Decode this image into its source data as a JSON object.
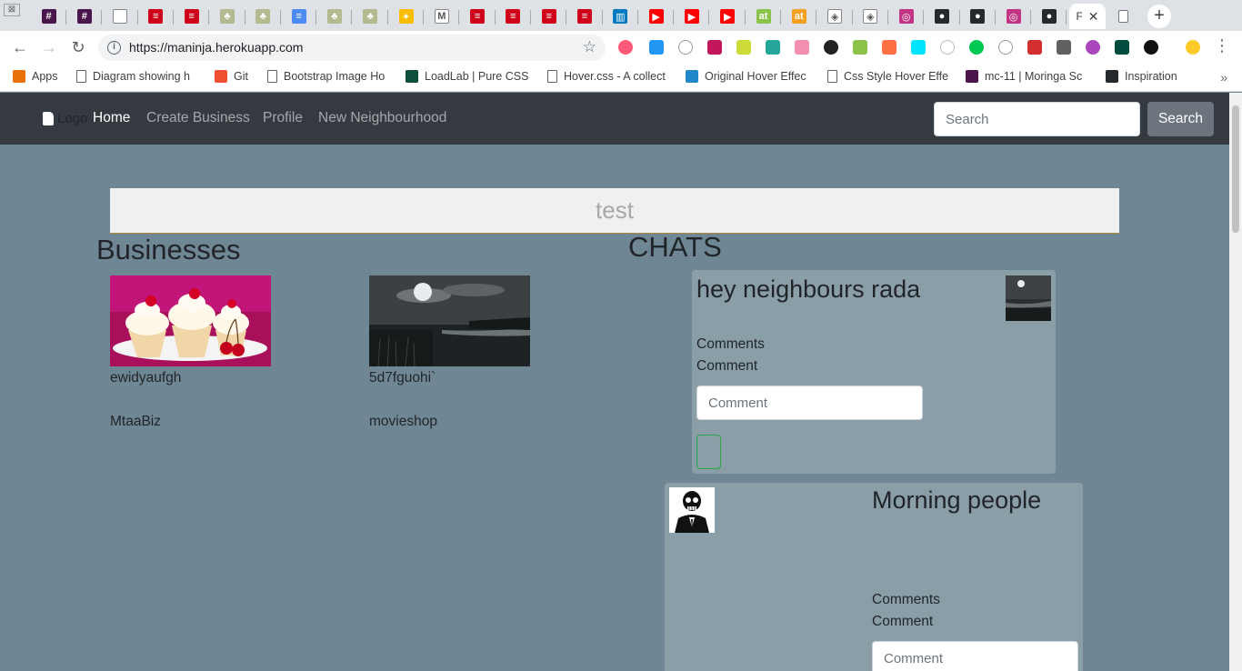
{
  "browser": {
    "tabs": [
      {
        "icon": "slack-hash-icon",
        "color": "#4a154b",
        "glyph": "#"
      },
      {
        "icon": "slack-hash-icon",
        "color": "#4a154b",
        "glyph": "#"
      },
      {
        "icon": "page-icon",
        "color": "#ffffff",
        "glyph": ""
      },
      {
        "icon": "red-bars-icon",
        "color": "#d0021b",
        "glyph": "≡"
      },
      {
        "icon": "red-bars-icon",
        "color": "#d0021b",
        "glyph": "≡"
      },
      {
        "icon": "tree-icon",
        "color": "#b5b98f",
        "glyph": "♣"
      },
      {
        "icon": "tree-icon",
        "color": "#b5b98f",
        "glyph": "♣"
      },
      {
        "icon": "docs-icon",
        "color": "#4c8bf5",
        "glyph": "≡"
      },
      {
        "icon": "tree-icon",
        "color": "#b5b98f",
        "glyph": "♣"
      },
      {
        "icon": "tree-icon",
        "color": "#b5b98f",
        "glyph": "♣"
      },
      {
        "icon": "keep-bulb-icon",
        "color": "#fbbc04",
        "glyph": "✦"
      },
      {
        "icon": "gmail-icon",
        "color": "#ffffff",
        "glyph": "M"
      },
      {
        "icon": "red-bars-icon",
        "color": "#d0021b",
        "glyph": "≡"
      },
      {
        "icon": "red-bars-icon",
        "color": "#d0021b",
        "glyph": "≡"
      },
      {
        "icon": "red-bars-icon",
        "color": "#d0021b",
        "glyph": "≡"
      },
      {
        "icon": "red-bars-icon",
        "color": "#d0021b",
        "glyph": "≡"
      },
      {
        "icon": "trello-icon",
        "color": "#0079bf",
        "glyph": "▥"
      },
      {
        "icon": "youtube-icon",
        "color": "#ff0000",
        "glyph": "▶"
      },
      {
        "icon": "youtube-icon",
        "color": "#ff0000",
        "glyph": "▶"
      },
      {
        "icon": "youtube-icon",
        "color": "#ff0000",
        "glyph": "▶"
      },
      {
        "icon": "at-icon",
        "color": "#8bc34a",
        "glyph": "at"
      },
      {
        "icon": "at-icon",
        "color": "#f4a020",
        "glyph": "at"
      },
      {
        "icon": "codepen-icon",
        "color": "#ffffff",
        "glyph": "◈"
      },
      {
        "icon": "codepen-icon",
        "color": "#ffffff",
        "glyph": "◈"
      },
      {
        "icon": "instagram-icon",
        "color": "#c13584",
        "glyph": "◎"
      },
      {
        "icon": "github-icon",
        "color": "#24292e",
        "glyph": "●"
      },
      {
        "icon": "github-icon",
        "color": "#24292e",
        "glyph": "●"
      },
      {
        "icon": "instagram-icon",
        "color": "#c13584",
        "glyph": "◎"
      },
      {
        "icon": "github-icon",
        "color": "#24292e",
        "glyph": "●"
      }
    ],
    "active_tab": {
      "title": "F",
      "close": "✕"
    },
    "url": "https://maninja.herokuapp.com",
    "bookmarks": [
      {
        "label": "Apps",
        "icon": "apps-grid-icon",
        "color": "#e8710a"
      },
      {
        "label": "Diagram showing h",
        "icon": "page-icon",
        "color": "#ffffff"
      },
      {
        "label": "Git",
        "icon": "git-icon",
        "color": "#f05032"
      },
      {
        "label": "Bootstrap Image Ho",
        "icon": "page-icon",
        "color": "#ffffff"
      },
      {
        "label": "LoadLab | Pure CSS",
        "icon": "ef-icon",
        "color": "#0b4f3c"
      },
      {
        "label": "Hover.css - A collect",
        "icon": "page-icon",
        "color": "#ffffff"
      },
      {
        "label": "Original Hover Effec",
        "icon": "drop-icon",
        "color": "#1e88c8"
      },
      {
        "label": "Css Style Hover Effe",
        "icon": "page-icon",
        "color": "#ffffff"
      },
      {
        "label": "mc-11 | Moringa Sc",
        "icon": "slack-hash-icon",
        "color": "#4a154b"
      },
      {
        "label": "Inspiration",
        "icon": "github-icon",
        "color": "#24292e"
      }
    ],
    "more": "»"
  },
  "navbar": {
    "brand": "Logo",
    "links": [
      "Home",
      "Create Business",
      "Profile",
      "New Neighbourhood"
    ],
    "search_placeholder": "Search",
    "search_button": "Search"
  },
  "banner": {
    "text": "test"
  },
  "businesses": {
    "heading": "Businesses",
    "items": [
      {
        "description": "ewidyaufgh",
        "name": "MtaaBiz",
        "image": "cupcakes"
      },
      {
        "description": "5d7fguohi`",
        "name": "movieshop",
        "image": "moonlit-lake"
      }
    ]
  },
  "chats": {
    "heading": "CHATS",
    "items": [
      {
        "title": "hey neighbours rada",
        "comments_label": "Comments",
        "comment_label": "Comment",
        "placeholder": "Comment",
        "image": "moonlit-lake"
      },
      {
        "title": "Morning people",
        "comments_label": "Comments",
        "comment_label": "Comment",
        "placeholder": "Comment",
        "image": "skull-suit"
      }
    ]
  },
  "colors": {
    "page_bg": "#6f8794",
    "navbar_bg": "#343a40",
    "card_bg": "#8a9ea8",
    "button_gray": "#6c757d",
    "submit_border": "#28a745"
  }
}
